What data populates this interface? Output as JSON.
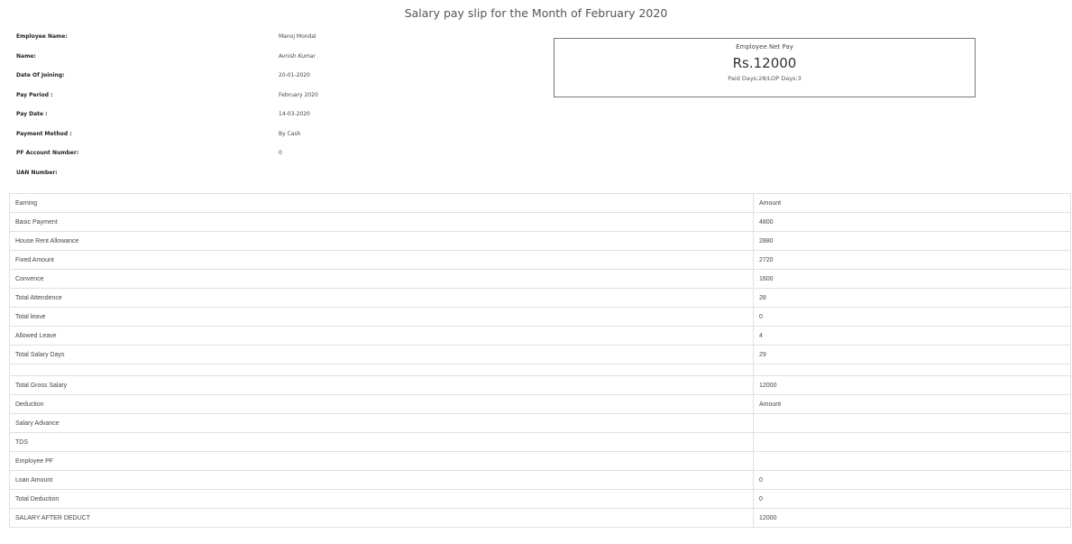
{
  "title": "Salary pay slip for the Month of February 2020",
  "employee_info": [
    {
      "label": "Employee Name:",
      "value": "Manoj Mondal"
    },
    {
      "label": "Name:",
      "value": "Avnish Kumar"
    },
    {
      "label": "Date Of Joining:",
      "value": "20-01-2020"
    },
    {
      "label": "Pay Period :",
      "value": "February 2020"
    },
    {
      "label": "Pay Date :",
      "value": "14-03-2020"
    },
    {
      "label": "Payment Method :",
      "value": "By Cash"
    },
    {
      "label": "PF Account Number:",
      "value": "0"
    },
    {
      "label": "UAN Number:",
      "value": ""
    }
  ],
  "net_pay": {
    "label": "Employee Net Pay",
    "amount": "Rs.12000",
    "days": "Paid Days:28/LOP Days:3"
  },
  "table": {
    "rows": [
      {
        "item": "Earning",
        "amount": "Amount"
      },
      {
        "item": "Basic Payment",
        "amount": "4800"
      },
      {
        "item": "House Rent Allowance",
        "amount": "2880"
      },
      {
        "item": "Fixed Amount",
        "amount": "2720"
      },
      {
        "item": "Convence",
        "amount": "1600"
      },
      {
        "item": "Total Attendence",
        "amount": "28"
      },
      {
        "item": "Total leave",
        "amount": "0"
      },
      {
        "item": "Allowed Leave",
        "amount": "4"
      },
      {
        "item": "Total Salary Days",
        "amount": "29"
      },
      {
        "item": "",
        "amount": ""
      },
      {
        "item": "Total Gross Salary",
        "amount": "12000"
      },
      {
        "item": "Deduction",
        "amount": "Amount"
      },
      {
        "item": "Salary Advance",
        "amount": ""
      },
      {
        "item": "TDS",
        "amount": ""
      },
      {
        "item": "Employee PF",
        "amount": ""
      },
      {
        "item": "Loan Amount",
        "amount": "0"
      },
      {
        "item": "Total Deduction",
        "amount": "0"
      },
      {
        "item": "SALARY AFTER DEDUCT",
        "amount": "12000"
      }
    ]
  }
}
